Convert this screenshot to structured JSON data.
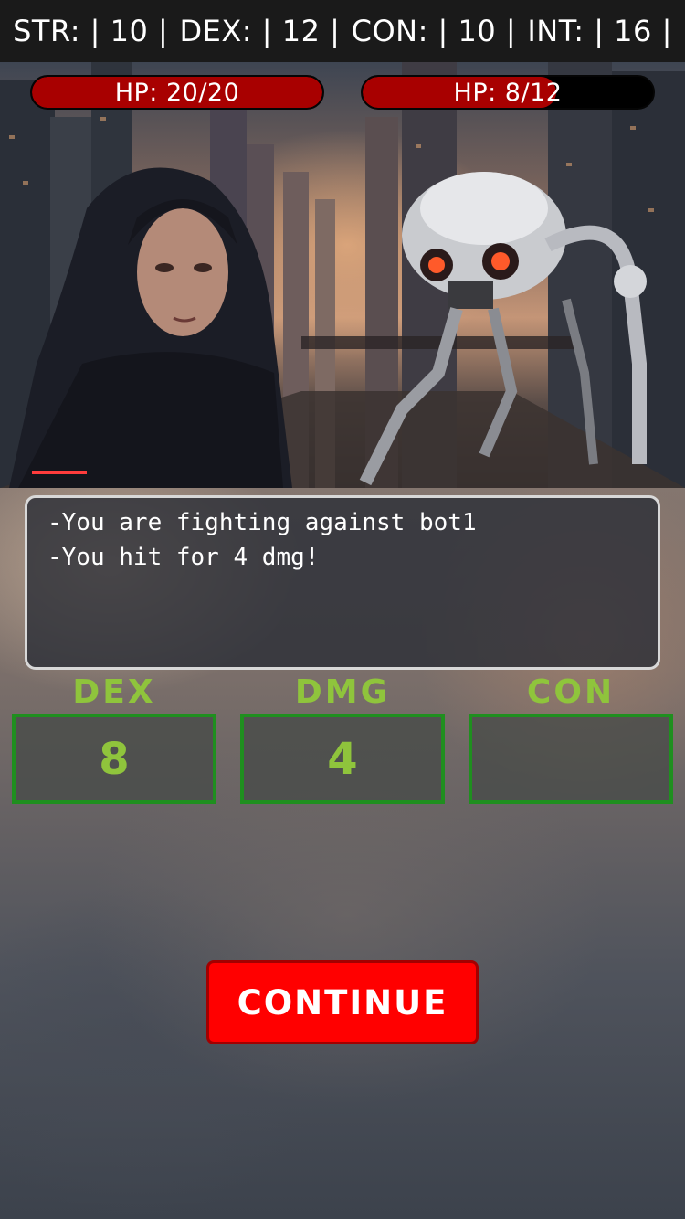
{
  "stats": [
    {
      "label": "STR: | 10 |"
    },
    {
      "label": "DEX: | 12 |"
    },
    {
      "label": "CON: | 10 |"
    },
    {
      "label": "INT: | 16 |"
    }
  ],
  "player": {
    "hp_text": "HP: 20/20",
    "hp_current": 20,
    "hp_max": 20
  },
  "enemy": {
    "hp_text": "HP: 8/12",
    "hp_current": 8,
    "hp_max": 12
  },
  "log": {
    "lines": [
      "-You are fighting against bot1",
      "-You hit for 4 dmg!"
    ]
  },
  "rolls": [
    {
      "label": "DEX",
      "value": "8"
    },
    {
      "label": "DMG",
      "value": "4"
    },
    {
      "label": "CON",
      "value": ""
    }
  ],
  "continue_label": "CONTINUE",
  "colors": {
    "hp_fill": "#a80000",
    "roll_accent": "#8fc43c",
    "roll_border": "#1f8f1f",
    "continue_bg": "#ff0000"
  }
}
